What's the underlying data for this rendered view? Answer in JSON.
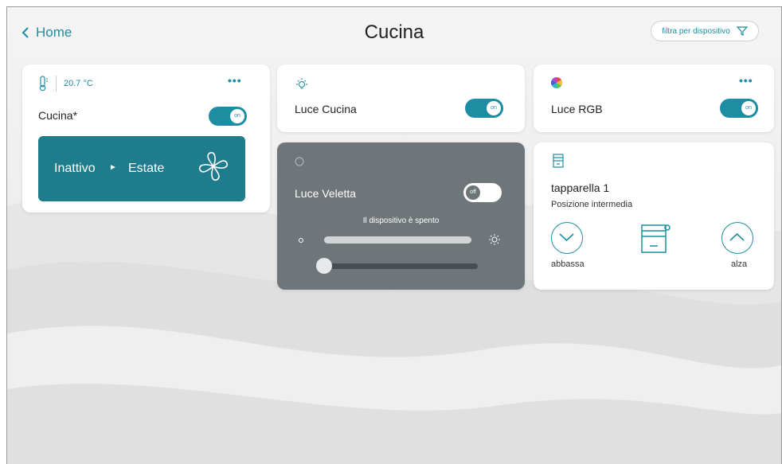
{
  "header": {
    "back_label": "Home",
    "title": "Cucina",
    "filter_label": "filtra per dispositivo"
  },
  "colors": {
    "accent": "#1d8ea1",
    "panel": "#1e7c8c",
    "disabled_card": "#6f7679"
  },
  "thermostat": {
    "temperature": "20.7 °C",
    "name": "Cucina*",
    "toggle": "on",
    "mode": "Inattivo",
    "season": "Estate"
  },
  "light_cucina": {
    "name": "Luce Cucina",
    "toggle": "on",
    "icon": "bulb-icon"
  },
  "light_rgb": {
    "name": "Luce RGB",
    "toggle": "on",
    "icon": "color-wheel-icon"
  },
  "light_veletta": {
    "name": "Luce Veletta",
    "toggle": "off",
    "status": "Il dispositivo è spento"
  },
  "shutter": {
    "name": "tapparella 1",
    "position": "Posizione intermedia",
    "down_label": "abbassa",
    "up_label": "alza"
  }
}
